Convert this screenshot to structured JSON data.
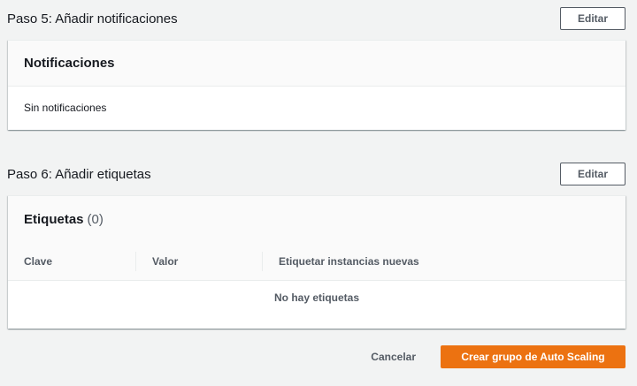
{
  "step5": {
    "title": "Paso 5: Añadir notificaciones",
    "edit_label": "Editar",
    "card_title": "Notificaciones",
    "body_text": "Sin notificaciones"
  },
  "step6": {
    "title": "Paso 6: Añadir etiquetas",
    "edit_label": "Editar",
    "card_title": "Etiquetas",
    "count": "(0)",
    "columns": [
      "Clave",
      "Valor",
      "Etiquetar instancias nuevas"
    ],
    "empty_text": "No hay etiquetas"
  },
  "footer": {
    "cancel_label": "Cancelar",
    "create_label": "Crear grupo de Auto Scaling"
  },
  "colors": {
    "primary": "#ec7211",
    "background": "#f2f3f3",
    "text": "#16191f",
    "secondary_text": "#545b64"
  }
}
